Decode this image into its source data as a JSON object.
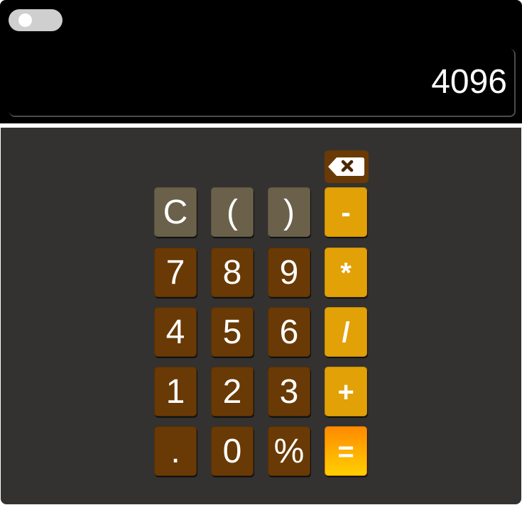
{
  "display": {
    "value": "4096"
  },
  "theme_toggle": {
    "state": "off"
  },
  "keypad": {
    "backspace_icon": "backspace-icon",
    "rows": [
      [
        {
          "label": "C",
          "name": "clear-button",
          "kind": "fn"
        },
        {
          "label": "(",
          "name": "open-paren-button",
          "kind": "fn"
        },
        {
          "label": ")",
          "name": "close-paren-button",
          "kind": "fn"
        },
        {
          "label": "-",
          "name": "minus-button",
          "kind": "op"
        }
      ],
      [
        {
          "label": "7",
          "name": "digit-7-button",
          "kind": "num"
        },
        {
          "label": "8",
          "name": "digit-8-button",
          "kind": "num"
        },
        {
          "label": "9",
          "name": "digit-9-button",
          "kind": "num"
        },
        {
          "label": "*",
          "name": "multiply-button",
          "kind": "op"
        }
      ],
      [
        {
          "label": "4",
          "name": "digit-4-button",
          "kind": "num"
        },
        {
          "label": "5",
          "name": "digit-5-button",
          "kind": "num"
        },
        {
          "label": "6",
          "name": "digit-6-button",
          "kind": "num"
        },
        {
          "label": "/",
          "name": "divide-button",
          "kind": "op"
        }
      ],
      [
        {
          "label": "1",
          "name": "digit-1-button",
          "kind": "num"
        },
        {
          "label": "2",
          "name": "digit-2-button",
          "kind": "num"
        },
        {
          "label": "3",
          "name": "digit-3-button",
          "kind": "num"
        },
        {
          "label": "+",
          "name": "plus-button",
          "kind": "op"
        }
      ],
      [
        {
          "label": ".",
          "name": "decimal-button",
          "kind": "num"
        },
        {
          "label": "0",
          "name": "digit-0-button",
          "kind": "num"
        },
        {
          "label": "%",
          "name": "percent-button",
          "kind": "num"
        },
        {
          "label": "=",
          "name": "equals-button",
          "kind": "eq"
        }
      ]
    ]
  },
  "colors": {
    "top_background": "#000000",
    "keypad_background": "#333231",
    "function_key": "#6b614b",
    "number_key": "#693a05",
    "operator_key": "#e2a107",
    "equals_gradient_top": "#ff8a00",
    "equals_gradient_bottom": "#ffd000"
  }
}
